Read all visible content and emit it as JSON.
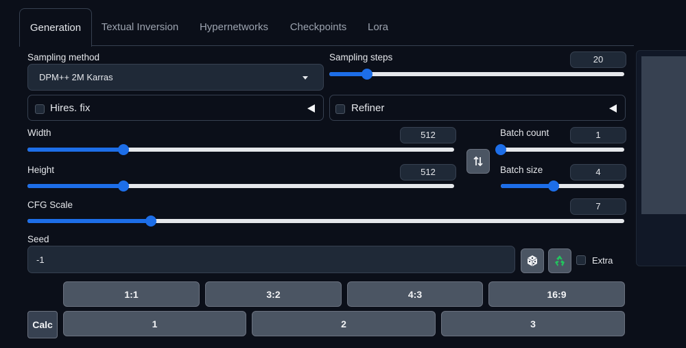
{
  "tabs": [
    {
      "label": "Generation",
      "active": true
    },
    {
      "label": "Textual Inversion"
    },
    {
      "label": "Hypernetworks"
    },
    {
      "label": "Checkpoints"
    },
    {
      "label": "Lora"
    }
  ],
  "sampling_method": {
    "label": "Sampling method",
    "value": "DPM++ 2M Karras"
  },
  "sampling_steps": {
    "label": "Sampling steps",
    "value": "20",
    "min": 1,
    "max": 150
  },
  "hires_fix": {
    "label": "Hires. fix",
    "checked": false
  },
  "refiner": {
    "label": "Refiner",
    "checked": false
  },
  "width": {
    "label": "Width",
    "value": "512",
    "min": 64,
    "max": 2048
  },
  "height": {
    "label": "Height",
    "value": "512",
    "min": 64,
    "max": 2048
  },
  "batch_count": {
    "label": "Batch count",
    "value": "1",
    "min": 1,
    "max": 100
  },
  "batch_size": {
    "label": "Batch size",
    "value": "4",
    "min": 1,
    "max": 8
  },
  "cfg_scale": {
    "label": "CFG Scale",
    "value": "7",
    "min": 1,
    "max": 30
  },
  "seed": {
    "label": "Seed",
    "value": "-1",
    "extra_label": "Extra"
  },
  "aspect_buttons": [
    "1:1",
    "3:2",
    "4:3",
    "16:9"
  ],
  "calc_label": "Calc",
  "multiplier_buttons": [
    "1",
    "2",
    "3"
  ],
  "colors": {
    "accent": "#1d6ee8",
    "background": "#0b0f19",
    "input": "#1f2937",
    "button": "#4b5563"
  },
  "icons": {
    "swap": "swap-dimensions-icon",
    "dice": "dice-icon",
    "recycle": "recycle-icon",
    "dropdown": "dropdown-arrow-icon"
  }
}
